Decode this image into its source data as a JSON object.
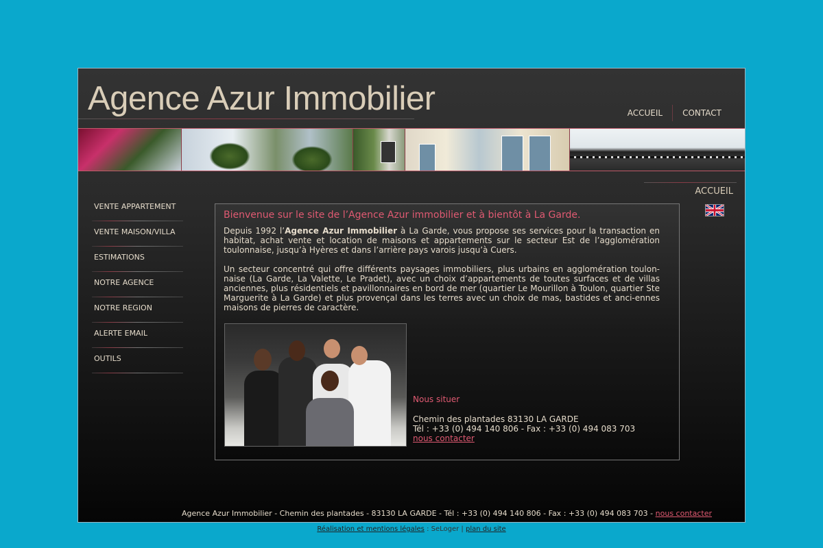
{
  "site": {
    "logo": "Agence Azur Immobilier"
  },
  "topnav": {
    "items": [
      "ACCUEIL",
      "CONTACT"
    ]
  },
  "breadcrumb": "ACCUEIL",
  "leftnav": {
    "items": [
      "VENTE APPARTEMENT",
      "VENTE MAISON/VILLA",
      "ESTIMATIONS",
      "NOTRE AGENCE",
      "NOTRE REGION",
      "ALERTE EMAIL",
      "OUTILS"
    ]
  },
  "content": {
    "welcome": "Bienvenue sur le site de l’Agence Azur immobilier et à bientôt à La Garde.",
    "p1_pre": "Depuis 1992 l’",
    "p1_bold": "Agence Azur Immobilier",
    "p1_post": " à La Garde, vous propose ses services pour la transaction en habitat, achat vente et location de maisons et appartements sur le secteur Est de l’agglomération toulonnaise, jusqu’à Hyères et dans l’arrière pays varois jusqu’à Cuers.",
    "p2": "Un secteur concentré qui offre différents paysages immobiliers, plus urbains en agglomération toulon-naise (La Garde, La Valette, Le Pradet), avec un choix d’appartements de toutes surfaces et de villas anciennes, plus résidentiels et pavillonnaires en bord de mer (quartier Le Mourillon à Toulon, quartier Ste Marguerite à La Garde) et plus provençal dans les terres avec un choix de mas, bastides et anci-ennes maisons de pierres de caractère.",
    "locate_title": "Nous situer",
    "address": "Chemin des plantades 83130 LA GARDE",
    "phone_fax": "Tél : +33 (0) 494 140 806 - Fax : +33 (0) 494 083 703",
    "contact_link": "nous contacter"
  },
  "footer": {
    "text": "Agence Azur Immobilier - Chemin des plantades - 83130 LA GARDE - Tél : +33 (0) 494 140 806 - Fax : +33 (0) 494 083 703 - ",
    "link": "nous contacter"
  },
  "below": {
    "legal": "Réalisation et mentions légales",
    "sep1": " : SeLoger | ",
    "sitemap": "plan du site"
  },
  "colors": {
    "background": "#0aa8cc",
    "accent": "#e05a72",
    "text": "#e6dccb"
  }
}
